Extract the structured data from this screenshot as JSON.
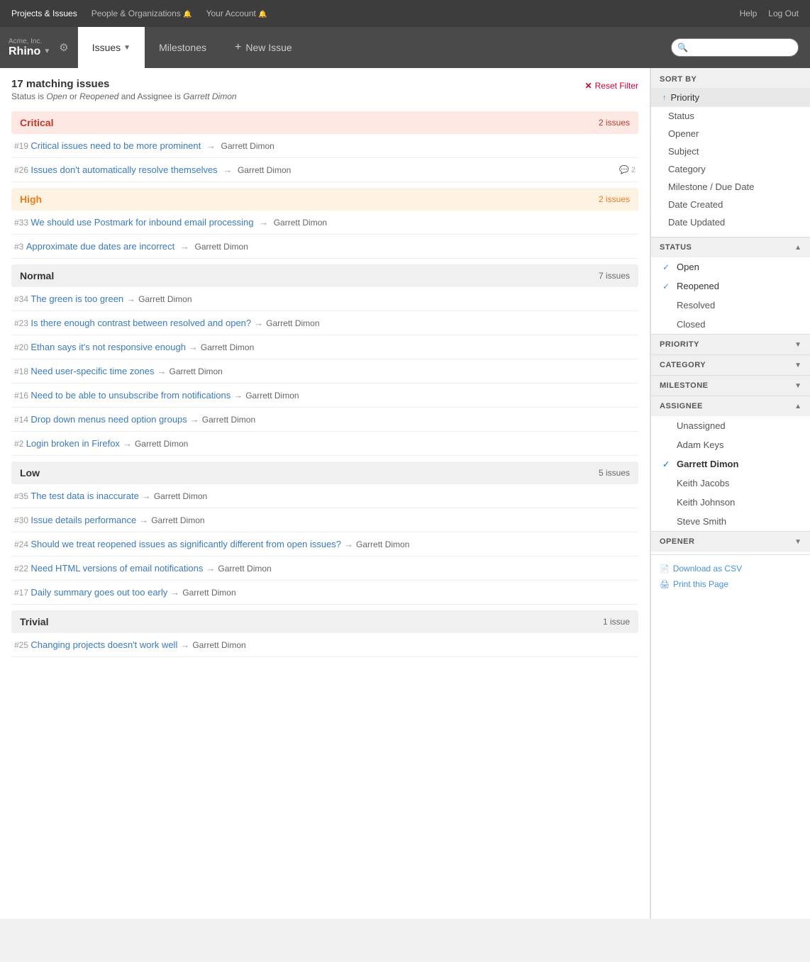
{
  "topNav": {
    "links": [
      {
        "label": "Projects & Issues",
        "active": true
      },
      {
        "label": "People & Organizations 🔔"
      },
      {
        "label": "Your Account 🔔"
      }
    ],
    "rightLinks": [
      "Help",
      "Log Out"
    ]
  },
  "header": {
    "projectLabel": "Acme, Inc.",
    "projectName": "Rhino",
    "tabs": [
      {
        "label": "Issues",
        "active": true,
        "hasDropdown": true
      },
      {
        "label": "Milestones",
        "active": false
      },
      {
        "label": "+ New Issue",
        "active": false,
        "isAction": true
      }
    ],
    "searchPlaceholder": ""
  },
  "issuesPanel": {
    "matchCount": "17 matching issues",
    "filterDesc": "Status is Open or Reopened and Assignee is Garrett Dimon",
    "resetFilter": "Reset Filter",
    "groups": [
      {
        "priority": "Critical",
        "priorityClass": "critical",
        "count": "2 issues",
        "issues": [
          {
            "num": "#19",
            "title": "Critical issues need to be more prominent",
            "assignee": "Garrett Dimon",
            "comments": null
          },
          {
            "num": "#26",
            "title": "Issues don't automatically resolve themselves",
            "assignee": "Garrett Dimon",
            "comments": "2"
          }
        ]
      },
      {
        "priority": "High",
        "priorityClass": "high",
        "count": "2 issues",
        "issues": [
          {
            "num": "#33",
            "title": "We should use Postmark for inbound email processing",
            "assignee": "Garrett Dimon",
            "comments": null
          },
          {
            "num": "#3",
            "title": "Approximate due dates are incorrect",
            "assignee": "Garrett Dimon",
            "comments": null
          }
        ]
      },
      {
        "priority": "Normal",
        "priorityClass": "normal",
        "count": "7 issues",
        "issues": [
          {
            "num": "#34",
            "title": "The green is too green",
            "assignee": "Garrett Dimon",
            "comments": null
          },
          {
            "num": "#23",
            "title": "Is there enough contrast between resolved and open?",
            "assignee": "Garrett Dimon",
            "comments": null
          },
          {
            "num": "#20",
            "title": "Ethan says it's not responsive enough",
            "assignee": "Garrett Dimon",
            "comments": null
          },
          {
            "num": "#18",
            "title": "Need user-specific time zones",
            "assignee": "Garrett Dimon",
            "comments": null
          },
          {
            "num": "#16",
            "title": "Need to be able to unsubscribe from notifications",
            "assignee": "Garrett Dimon",
            "comments": null
          },
          {
            "num": "#14",
            "title": "Drop down menus need option groups",
            "assignee": "Garrett Dimon",
            "comments": null
          },
          {
            "num": "#2",
            "title": "Login broken in Firefox",
            "assignee": "Garrett Dimon",
            "comments": null
          }
        ]
      },
      {
        "priority": "Low",
        "priorityClass": "low",
        "count": "5 issues",
        "issues": [
          {
            "num": "#35",
            "title": "The test data is inaccurate",
            "assignee": "Garrett Dimon",
            "comments": null
          },
          {
            "num": "#30",
            "title": "Issue details performance",
            "assignee": "Garrett Dimon",
            "comments": null
          },
          {
            "num": "#24",
            "title": "Should we treat reopened issues as significantly different from open issues?",
            "assignee": "Garrett Dimon",
            "comments": null
          },
          {
            "num": "#22",
            "title": "Need HTML versions of email notifications",
            "assignee": "Garrett Dimon",
            "comments": null
          },
          {
            "num": "#17",
            "title": "Daily summary goes out too early",
            "assignee": "Garrett Dimon",
            "comments": null
          }
        ]
      },
      {
        "priority": "Trivial",
        "priorityClass": "trivial",
        "count": "1 issue",
        "issues": [
          {
            "num": "#25",
            "title": "Changing projects doesn't work well",
            "assignee": "Garrett Dimon",
            "comments": null
          }
        ]
      }
    ]
  },
  "sidebar": {
    "sortTitle": "SORT BY",
    "sortItems": [
      {
        "label": "Priority",
        "active": true,
        "arrow": "↑"
      },
      {
        "label": "Status"
      },
      {
        "label": "Opener"
      },
      {
        "label": "Subject"
      },
      {
        "label": "Category"
      },
      {
        "label": "Milestone / Due Date"
      },
      {
        "label": "Date Created"
      },
      {
        "label": "Date Updated"
      }
    ],
    "filterSections": [
      {
        "title": "STATUS",
        "expanded": true,
        "items": [
          {
            "label": "Open",
            "checked": true
          },
          {
            "label": "Reopened",
            "checked": true
          },
          {
            "label": "Resolved",
            "checked": false
          },
          {
            "label": "Closed",
            "checked": false
          }
        ]
      },
      {
        "title": "PRIORITY",
        "expanded": false,
        "items": []
      },
      {
        "title": "CATEGORY",
        "expanded": false,
        "items": []
      },
      {
        "title": "MILESTONE",
        "expanded": false,
        "items": []
      },
      {
        "title": "ASSIGNEE",
        "expanded": true,
        "items": [
          {
            "label": "Unassigned",
            "checked": false
          },
          {
            "label": "Adam Keys",
            "checked": false
          },
          {
            "label": "Garrett Dimon",
            "checked": true
          },
          {
            "label": "Keith Jacobs",
            "checked": false
          },
          {
            "label": "Keith Johnson",
            "checked": false
          },
          {
            "label": "Steve Smith",
            "checked": false
          }
        ]
      },
      {
        "title": "OPENER",
        "expanded": false,
        "items": []
      }
    ],
    "links": [
      {
        "label": "Download as CSV",
        "icon": "📄"
      },
      {
        "label": "Print this Page",
        "icon": "🖨"
      }
    ]
  }
}
